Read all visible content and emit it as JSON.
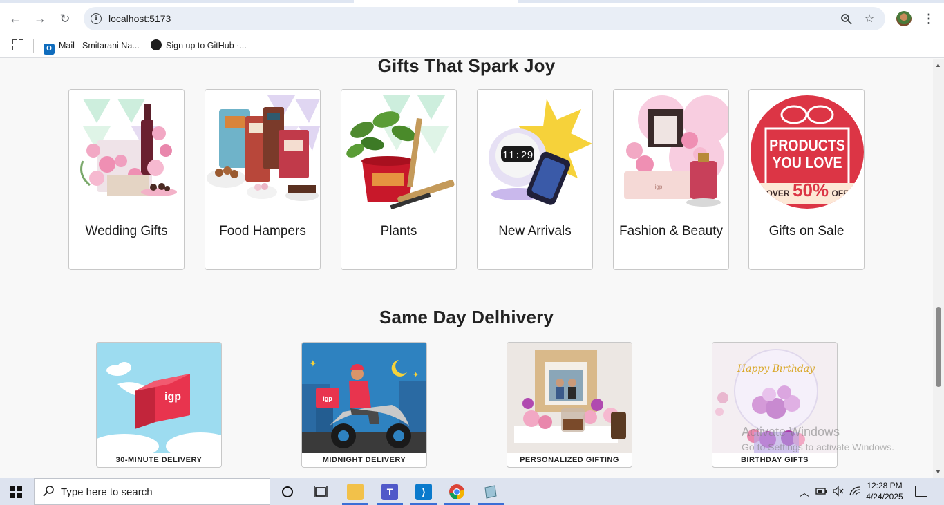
{
  "browser": {
    "url": "localhost:5173",
    "bookmarks": [
      {
        "label": "Mail - Smitarani Na..."
      },
      {
        "label": "Sign up to GitHub ·..."
      }
    ]
  },
  "page": {
    "gifts_section_title": "Gifts That Spark Joy",
    "gift_categories": [
      {
        "label": "Wedding Gifts"
      },
      {
        "label": "Food Hampers"
      },
      {
        "label": "Plants"
      },
      {
        "label": "New Arrivals"
      },
      {
        "label": "Fashion & Beauty"
      },
      {
        "label": "Gifts on Sale"
      }
    ],
    "sale_banner": {
      "line1": "PRODUCTS",
      "line2": "YOU LOVE",
      "prefix": "OVER",
      "percent": "50%",
      "suffix": "OFF"
    },
    "delivery_section_title": "Same Day Delhivery",
    "delivery_options": [
      {
        "label": "30-MINUTE DELIVERY",
        "logo": "igp"
      },
      {
        "label": "MIDNIGHT DELIVERY",
        "logo": "igp"
      },
      {
        "label": "PERSONALIZED GIFTING"
      },
      {
        "label": "BIRTHDAY GIFTS",
        "balloon_text": "Happy Birthday"
      }
    ]
  },
  "watermark": {
    "title": "Activate Windows",
    "subtitle": "Go to Settings to activate Windows."
  },
  "taskbar": {
    "search_placeholder": "Type here to search",
    "time": "12:28 PM",
    "date": "4/24/2025"
  },
  "colors": {
    "chrome_bg": "#ffffff",
    "omnibox_bg": "#e9eef6",
    "page_bg": "#f8f8f8",
    "taskbar_bg": "#dde3ef",
    "sale_red": "#dc3545"
  }
}
